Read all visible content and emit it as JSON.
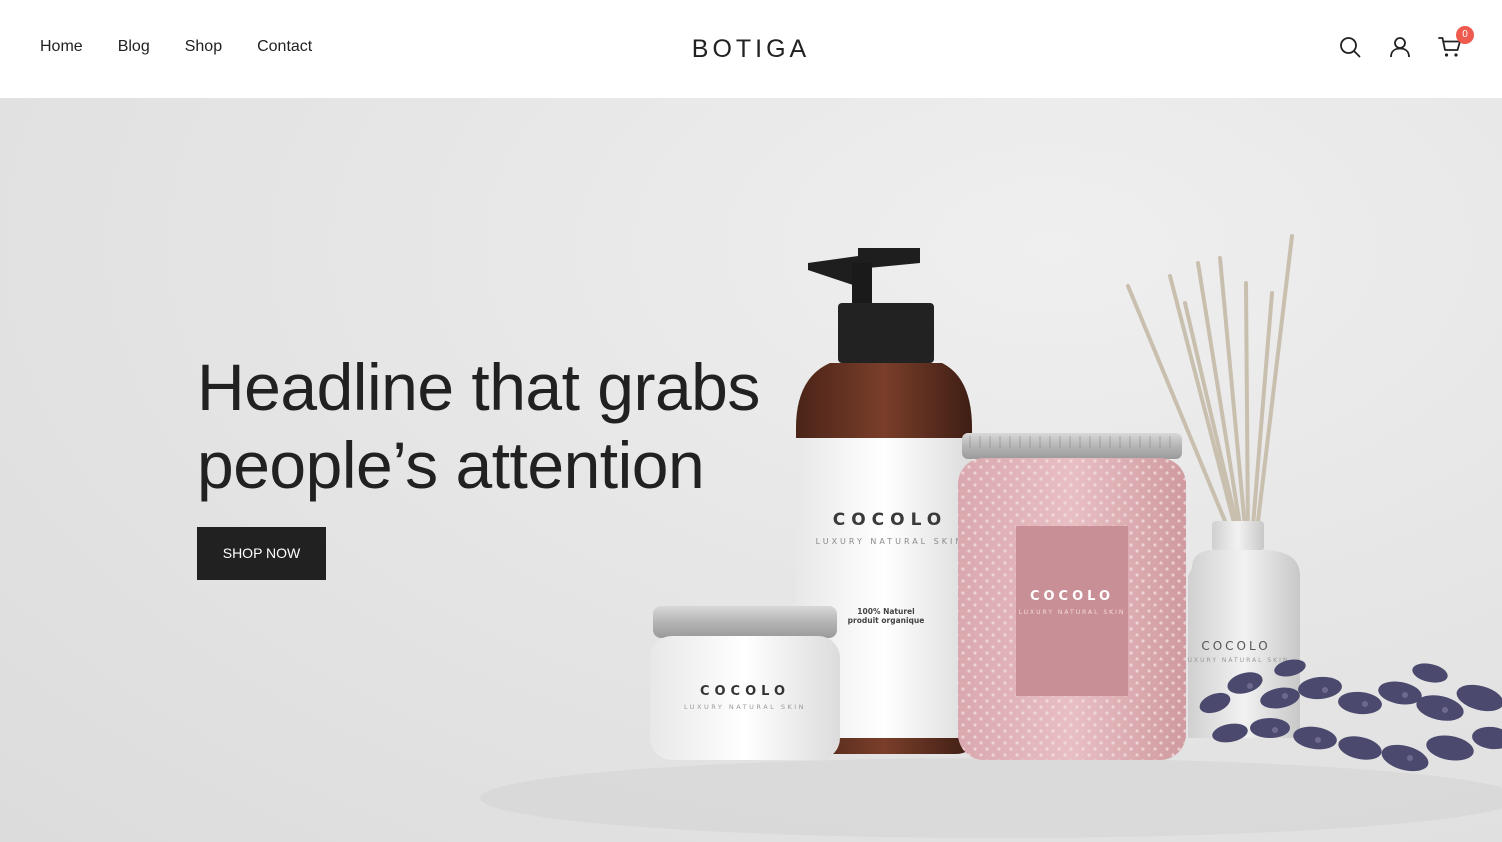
{
  "nav": {
    "items": [
      {
        "label": "Home"
      },
      {
        "label": "Blog"
      },
      {
        "label": "Shop"
      },
      {
        "label": "Contact"
      }
    ]
  },
  "brand": {
    "logo": "BOTIGA"
  },
  "header_icons": {
    "search": "search-icon",
    "account": "user-icon",
    "cart": "cart-icon",
    "cart_count": "0",
    "badge_color": "#ef5a4f"
  },
  "hero": {
    "headline": "Headline that grabs people’s attention",
    "cta_label": "SHOP NOW",
    "cta_color": "#212121",
    "product_labels": {
      "brand_name": "COCOLO",
      "tagline": "LUXURY NATURAL SKIN",
      "bottle_note_1": "100% Naturel",
      "bottle_note_2": "produit organique"
    }
  }
}
